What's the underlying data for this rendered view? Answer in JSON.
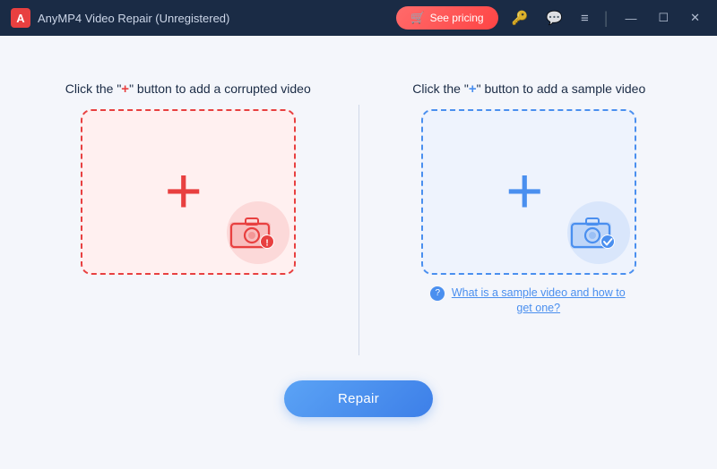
{
  "titlebar": {
    "logo_alt": "AnyMP4 logo",
    "title": "AnyMP4 Video Repair (Unregistered)",
    "see_pricing_label": "See pricing",
    "min_label": "—",
    "max_label": "☐",
    "close_label": "✕"
  },
  "main": {
    "corrupted_panel": {
      "label_prefix": "Click the \"",
      "label_plus": "+",
      "label_suffix": "\" button to add a corrupted video"
    },
    "sample_panel": {
      "label_prefix": "Click the \"",
      "label_plus": "+",
      "label_suffix": "\" button to add a sample video",
      "help_link": "What is a sample video and how to get one?"
    },
    "repair_button": "Repair"
  }
}
